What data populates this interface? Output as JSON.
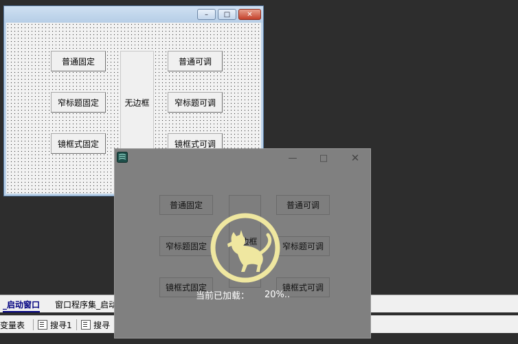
{
  "designer": {
    "buttons": {
      "putong_guding": "普通固定",
      "zhaibiaoti_guding": "窄标题固定",
      "jingkuangshi_guding": "镜框式固定",
      "wubiankuang": "无边框",
      "putong_ketiao": "普通可调",
      "zhaibiaoti_ketiao": "窄标题可调",
      "jingkuangshi_ketiao": "镜框式可调"
    },
    "caption_icons": [
      "minimize-icon",
      "maximize-icon",
      "close-icon"
    ]
  },
  "ide": {
    "tabs": [
      "_启动窗口",
      "窗口程序集_启动"
    ],
    "tools": [
      "变量表",
      "搜寻1",
      "搜寻"
    ]
  },
  "overlay": {
    "buttons": {
      "putong_guding": "普通固定",
      "zhaibiaoti_guding": "窄标题固定",
      "jingkuangshi_guding": "镜框式固定",
      "wubiankuang": "无边框",
      "putong_ketiao": "普通可调",
      "zhaibiaoti_ketiao": "窄标题可调",
      "jingkuangshi_ketiao": "镜框式可调"
    },
    "loading": {
      "label": "当前已加载：",
      "percent_text": "20%..",
      "progress": 0.2
    },
    "logo_icon": "cat-logo-icon",
    "colors": {
      "logo": "#efe7a0",
      "overlay_bg": "#808080"
    }
  }
}
